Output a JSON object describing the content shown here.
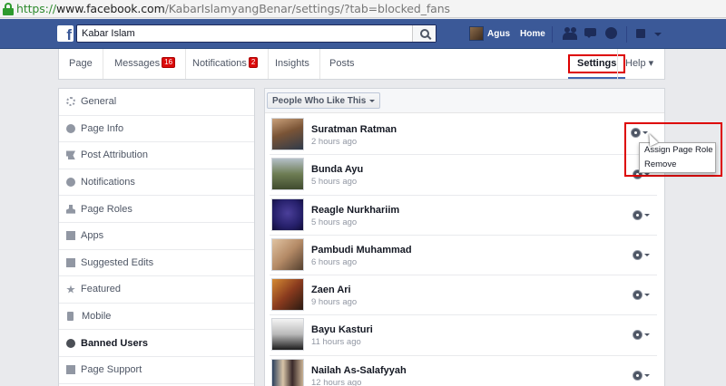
{
  "browser": {
    "url_scheme": "https://",
    "url_host": "www.facebook.com",
    "url_path": "/KabarIslamyangBenar/settings/?tab=blocked_fans"
  },
  "topbar": {
    "logo": "f",
    "search_value": "Kabar Islam",
    "user_name": "Agus",
    "home_label": "Home"
  },
  "pagenav": {
    "page": "Page",
    "messages": "Messages",
    "messages_count": "16",
    "notifications": "Notifications",
    "notifications_count": "2",
    "insights": "Insights",
    "posts": "Posts",
    "settings": "Settings",
    "help": "Help ▾"
  },
  "sidebar": {
    "items": [
      {
        "label": "General"
      },
      {
        "label": "Page Info"
      },
      {
        "label": "Post Attribution"
      },
      {
        "label": "Notifications"
      },
      {
        "label": "Page Roles"
      },
      {
        "label": "Apps"
      },
      {
        "label": "Suggested Edits"
      },
      {
        "label": "Featured"
      },
      {
        "label": "Mobile"
      },
      {
        "label": "Banned Users"
      },
      {
        "label": "Page Support"
      }
    ]
  },
  "main": {
    "filter_label": "People Who Like This",
    "people": [
      {
        "name": "Suratman Ratman",
        "time": "2 hours ago"
      },
      {
        "name": "Bunda Ayu",
        "time": "5 hours ago"
      },
      {
        "name": "Reagle Nurkhariim",
        "time": "5 hours ago"
      },
      {
        "name": "Pambudi Muhammad",
        "time": "6 hours ago"
      },
      {
        "name": "Zaen Ari",
        "time": "9 hours ago"
      },
      {
        "name": "Bayu Kasturi",
        "time": "11 hours ago"
      },
      {
        "name": "Nailah As-Salafyyah",
        "time": "12 hours ago"
      }
    ]
  },
  "dropdown": {
    "assign_role": "Assign Page Role",
    "remove": "Remove"
  },
  "colors": {
    "facebook_blue": "#3b5998",
    "highlight_red": "#dd0000",
    "badge_red": "#dc0a0a"
  }
}
